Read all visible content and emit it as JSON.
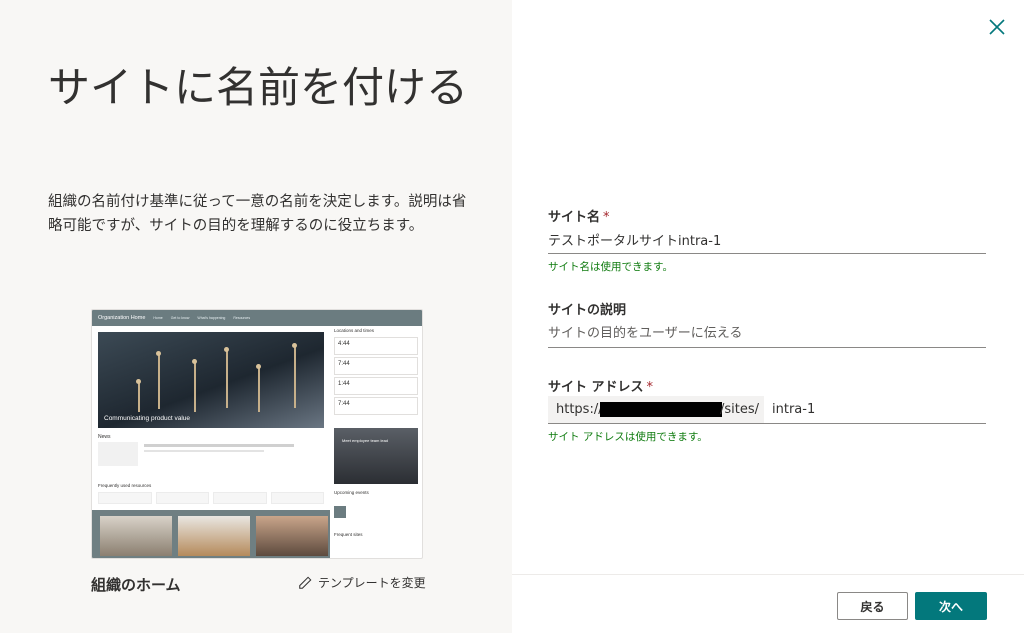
{
  "left": {
    "title": "サイトに名前を付ける",
    "description": "組織の名前付け基準に従って一意の名前を決定します。説明は省略可能ですが、サイトの目的を理解するのに役立ちます。",
    "template_name": "組織のホーム",
    "change_template": "テンプレートを変更",
    "preview": {
      "site_title": "Organization Home",
      "nav": [
        "Home",
        "Get to know",
        "What's happening",
        "Resources"
      ],
      "hero_text": "Communicating product value",
      "news_label": "News",
      "frequent_label": "Frequently used resources",
      "locations_label": "Locations and times",
      "times": [
        "4:44",
        "7:44",
        "1:44",
        "7:44"
      ],
      "events_label": "Upcoming events",
      "sites_label": "Frequent sites",
      "photo_text": "Meet employee team lead"
    }
  },
  "form": {
    "site_name_label": "サイト名",
    "site_name_value": "テストポータルサイトintra-1",
    "site_name_ok": "サイト名は使用できます。",
    "desc_label": "サイトの説明",
    "desc_placeholder": "サイトの目的をユーザーに伝える",
    "address_label": "サイト アドレス",
    "address_prefix": "https://",
    "address_suffix": "/sites/",
    "address_value": "intra-1",
    "address_ok": "サイト アドレスは使用できます。",
    "required_mark": "*"
  },
  "footer": {
    "back_label": "戻る",
    "next_label": "次へ"
  },
  "colors": {
    "accent": "#03787c",
    "success": "#107c10",
    "required": "#a4262c"
  }
}
